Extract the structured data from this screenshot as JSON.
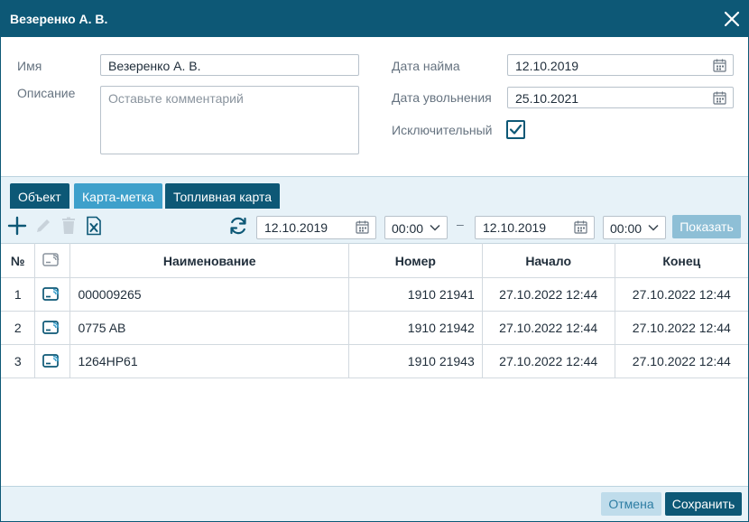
{
  "window": {
    "title": "Везеренко А. В."
  },
  "form": {
    "name_label": "Имя",
    "name_value": "Везеренко А. В.",
    "description_label": "Описание",
    "description_placeholder": "Оставьте комментарий",
    "hire_date_label": "Дата найма",
    "hire_date_value": "12.10.2019",
    "dismiss_date_label": "Дата увольнения",
    "dismiss_date_value": "25.10.2021",
    "exclusive_label": "Исключительный",
    "exclusive_checked": true
  },
  "tabs": [
    {
      "label": "Объект",
      "active": false
    },
    {
      "label": "Карта-метка",
      "active": true
    },
    {
      "label": "Топливная карта",
      "active": false
    }
  ],
  "toolbar": {
    "date_from": "12.10.2019",
    "time_from": "00:00",
    "separator": "–",
    "date_to": "12.10.2019",
    "time_to": "00:00",
    "show_label": "Показать"
  },
  "table": {
    "headers": {
      "num": "№",
      "name": "Наименование",
      "number": "Номер",
      "start": "Начало",
      "end": "Конец"
    },
    "rows": [
      {
        "num": "1",
        "name": "000009265",
        "number": "1910 21941",
        "start": "27.10.2022 12:44",
        "end": "27.10.2022 12:44"
      },
      {
        "num": "2",
        "name": "0775 AB",
        "number": "1910 21942",
        "start": "27.10.2022 12:44",
        "end": "27.10.2022 12:44"
      },
      {
        "num": "3",
        "name": "1264HP61",
        "number": "1910 21943",
        "start": "27.10.2022 12:44",
        "end": "27.10.2022 12:44"
      }
    ]
  },
  "footer": {
    "cancel_label": "Отмена",
    "save_label": "Сохранить"
  },
  "icons": {
    "close": "close-icon",
    "calendar": "calendar-icon",
    "check": "check-icon",
    "add": "plus-icon",
    "edit": "pencil-icon",
    "delete": "trash-icon",
    "export": "excel-icon",
    "refresh": "refresh-icon",
    "card": "rfid-card-icon"
  },
  "colors": {
    "primary": "#0d5876",
    "accent": "#3ea0cb",
    "panel": "#e7f2f8",
    "disabled_button": "#8ebfd6"
  }
}
